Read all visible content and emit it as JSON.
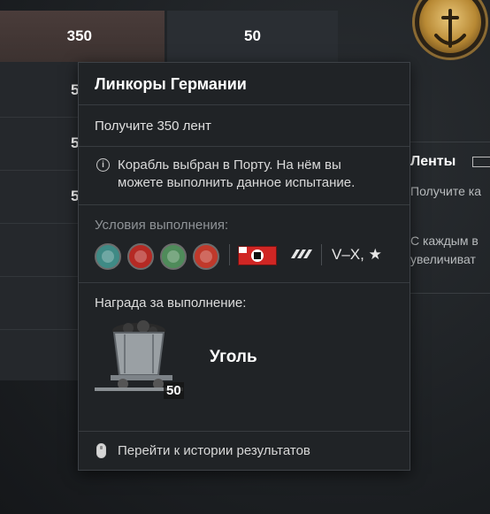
{
  "background": {
    "header_left": "350",
    "header_right": "50",
    "row_values": [
      "5",
      "5",
      "5"
    ],
    "side_panel": {
      "title": "Ленты",
      "line1": "Получите ка",
      "line2": "С каждым в",
      "line3": "увеличиват"
    }
  },
  "tooltip": {
    "title": "Линкоры Германии",
    "goal": "Получите 350 лент",
    "note": "Корабль выбран в Порту. На нём вы можете выполнить данное испытание.",
    "conditions_label": "Условия выполнения:",
    "conditions": {
      "badges": [
        {
          "icon": "teal-badge-icon",
          "color": "#3f8a85"
        },
        {
          "icon": "red-badge-icon",
          "color": "#b52a24"
        },
        {
          "icon": "green-badge-icon",
          "color": "#4f8b5a"
        },
        {
          "icon": "star-badge-icon",
          "color": "#c0392b"
        }
      ],
      "nation_flag": "germany-flag-icon",
      "ship_class": "battleship-class-icon",
      "tier": "V–X, ★"
    },
    "reward_label": "Награда за выполнение:",
    "reward": {
      "name": "Уголь",
      "quantity": "50",
      "icon": "coal-cart-icon"
    },
    "history_link": "Перейти к истории результатов"
  },
  "colors": {
    "tooltip_bg": "#202326",
    "accent_gold": "#b88934"
  }
}
